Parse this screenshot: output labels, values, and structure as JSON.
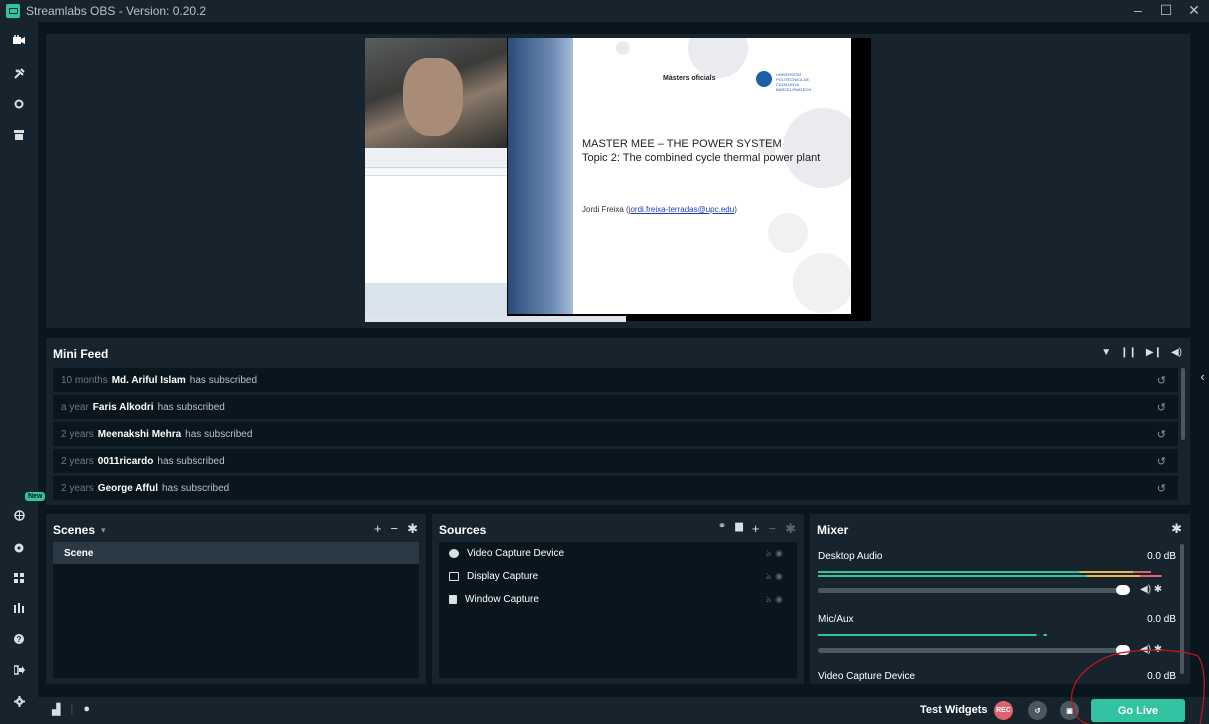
{
  "window": {
    "title": "Streamlabs OBS - Version: 0.20.2",
    "controls": [
      "–",
      "☐",
      "✕"
    ]
  },
  "nav": {
    "new_badge": "New",
    "icons": [
      "studio-camera-icon",
      "themes-icon",
      "live-icon",
      "store-icon",
      "globe-icon",
      "dashboard-icon",
      "grid-icon",
      "audio-bars-icon",
      "help-icon",
      "logout-icon",
      "settings-icon"
    ]
  },
  "preview": {
    "slide": {
      "masters_logo": "Màsters oficials",
      "upc_text": "UNIVERSITAT POLITÈCNICA DE CATALUNYA BARCELONATECH",
      "title1": "MASTER MEE – THE POWER SYSTEM",
      "title2": "Topic 2: The combined cycle thermal power plant",
      "author": "Jordi Freixa (",
      "email": "jordi.freixa-terradas@upc.edu",
      "author_end": ")"
    }
  },
  "mini_feed": {
    "title": "Mini Feed",
    "rows": [
      {
        "time": "10 months",
        "name": "Md. Ariful Islam",
        "action": "has subscribed"
      },
      {
        "time": "a year",
        "name": "Faris Alkodri",
        "action": "has subscribed"
      },
      {
        "time": "2 years",
        "name": "Meenakshi Mehra",
        "action": "has subscribed"
      },
      {
        "time": "2 years",
        "name": "0011ricardo",
        "action": "has subscribed"
      },
      {
        "time": "2 years",
        "name": "George Afful",
        "action": "has subscribed"
      }
    ],
    "replay_icon": "↺"
  },
  "scenes": {
    "title": "Scenes",
    "items": [
      "Scene"
    ]
  },
  "sources": {
    "title": "Sources",
    "items": [
      "Video Capture Device",
      "Display Capture",
      "Window Capture"
    ]
  },
  "mixer": {
    "title": "Mixer",
    "channels": [
      {
        "name": "Desktop Audio",
        "level": "0.0 dB"
      },
      {
        "name": "Mic/Aux",
        "level": "0.0 dB"
      },
      {
        "name": "Video Capture Device",
        "level": "0.0 dB"
      }
    ]
  },
  "footer": {
    "test_widgets": "Test Widgets",
    "rec_label": "REC",
    "go_live": "Go Live"
  },
  "colors": {
    "accent": "#31c3a2",
    "panel": "#17242d",
    "background": "#09161d",
    "rec": "#e0606e"
  }
}
